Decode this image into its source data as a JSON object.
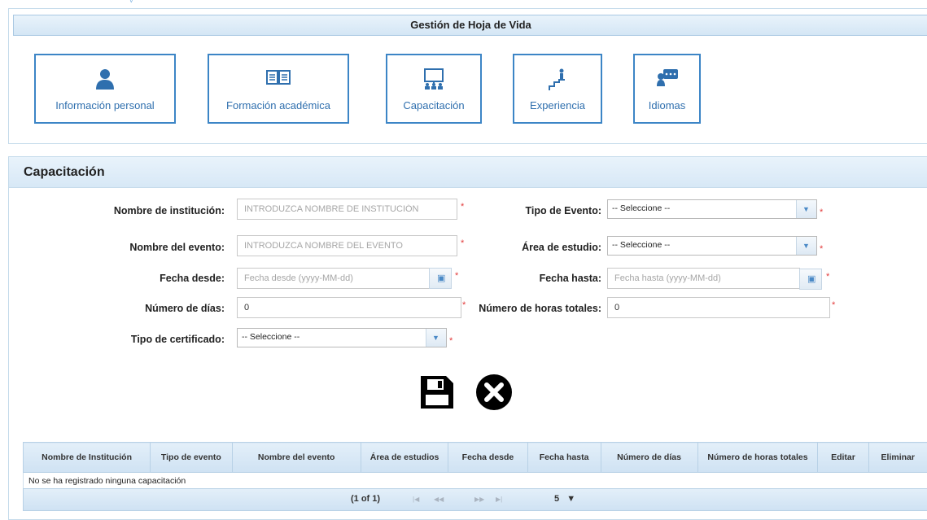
{
  "header": {
    "title": "Gestión de Hoja de Vida"
  },
  "nav": [
    {
      "label": "Información personal",
      "icon": "person-icon"
    },
    {
      "label": "Formación académica",
      "icon": "open-book-icon"
    },
    {
      "label": "Capacitación",
      "icon": "presentation-board-icon"
    },
    {
      "label": "Experiencia",
      "icon": "stairs-climb-icon"
    },
    {
      "label": "Idiomas",
      "icon": "speech-bubble-icon"
    }
  ],
  "form": {
    "title": "Capacitación",
    "institution": {
      "label": "Nombre de institución:",
      "placeholder": "INTRODUZCA NOMBRE DE INSTITUCIÓN"
    },
    "event_type": {
      "label": "Tipo de Evento:",
      "value": "-- Seleccione --"
    },
    "event_name": {
      "label": "Nombre del evento:",
      "placeholder": "INTRODUZCA NOMBRE DEL EVENTO"
    },
    "study_area": {
      "label": "Área de estudio:",
      "value": "-- Seleccione --"
    },
    "date_from": {
      "label": "Fecha desde:",
      "placeholder": "Fecha desde (yyyy-MM-dd)"
    },
    "date_to": {
      "label": "Fecha hasta:",
      "placeholder": "Fecha hasta (yyyy-MM-dd)"
    },
    "days": {
      "label": "Número de días:",
      "value": "0"
    },
    "hours": {
      "label": "Número de horas totales:",
      "value": "0"
    },
    "certificate_type": {
      "label": "Tipo de certificado:",
      "value": "-- Seleccione --"
    },
    "required_mark": "*"
  },
  "actions": {
    "save_icon": "floppy-disk-icon",
    "cancel_icon": "close-circle-icon"
  },
  "table": {
    "columns": [
      "Nombre de Institución",
      "Tipo de evento",
      "Nombre del evento",
      "Área de estudios",
      "Fecha desde",
      "Fecha hasta",
      "Número de días",
      "Número de horas totales",
      "Editar",
      "Eliminar"
    ],
    "empty_message": "No se ha registrado ninguna capacitación",
    "pager": {
      "page_info": "(1 of 1)",
      "rows_per_page": "5"
    }
  },
  "colors": {
    "accent": "#3c85c6",
    "header_bg": "#d4e6f5",
    "required": "#e23b3b"
  }
}
